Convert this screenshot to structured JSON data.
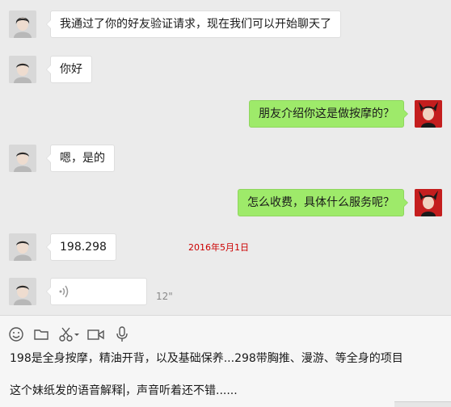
{
  "messages": [
    {
      "side": "left",
      "text": "我通过了你的好友验证请求，现在我们可以开始聊天了"
    },
    {
      "side": "left",
      "text": "你好"
    },
    {
      "side": "right",
      "text": "朋友介绍你这是做按摩的？"
    },
    {
      "side": "left",
      "text": "嗯，是的"
    },
    {
      "side": "right",
      "text": "怎么收费，具体什么服务呢？"
    },
    {
      "side": "left",
      "text": "198.298"
    },
    {
      "side": "left",
      "type": "voice",
      "duration": "12\"",
      "icon": "voice-wave-icon"
    }
  ],
  "annotation": {
    "date_text": "2016年5月1日",
    "color": "#cc0000"
  },
  "toolbar": {
    "icons": [
      "emoji-icon",
      "folder-icon",
      "scissors-icon",
      "video-call-icon",
      "microphone-icon"
    ]
  },
  "input": {
    "line1": "198是全身按摩，精油开背，以及基础保养...298带胸推、漫游、等全身的项目",
    "line2_before": "这个妹纸发的语音解释",
    "line2_after": "，声音听着还不错......"
  },
  "colors": {
    "chat_bg": "#ebebeb",
    "bubble_left": "#ffffff",
    "bubble_right": "#9eea6a",
    "input_bg": "#f6f6f6"
  }
}
